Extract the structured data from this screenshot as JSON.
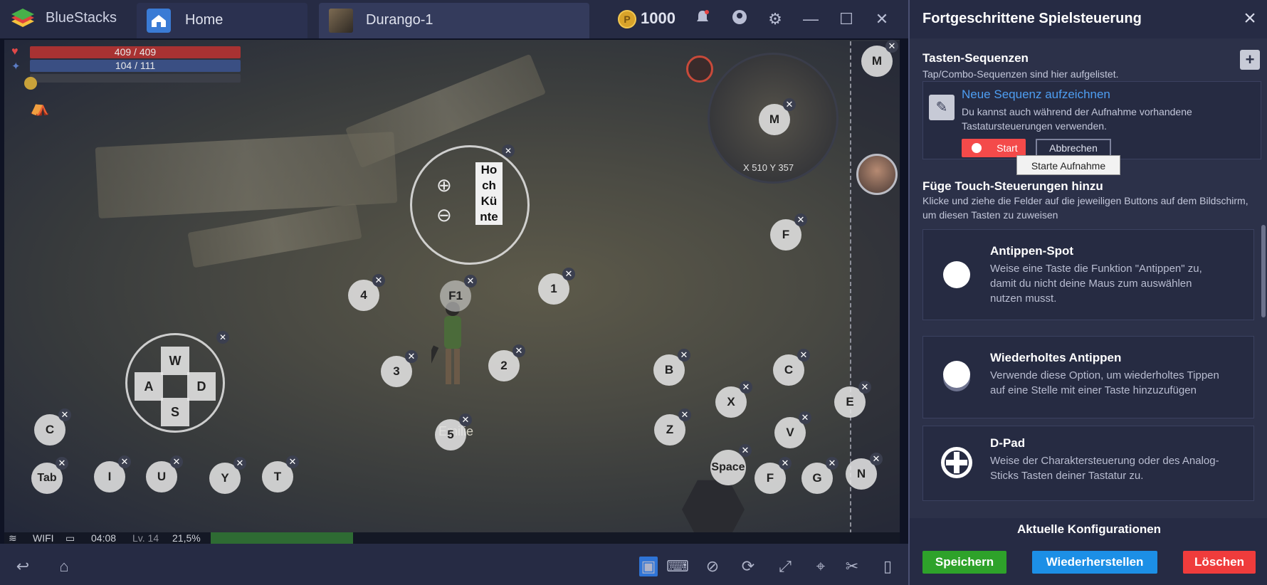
{
  "titlebar": {
    "brand": "BlueStacks",
    "tabs": [
      {
        "label": "Home",
        "icon": "home-icon"
      },
      {
        "label": "Durango-1",
        "icon": "game-thumbnail"
      }
    ],
    "coins": "1000",
    "icons": [
      "bell-icon",
      "account-icon",
      "gear-icon",
      "minimize-icon",
      "maximize-icon",
      "close-icon"
    ]
  },
  "game": {
    "hp": "409 / 409",
    "mp": "104 / 111",
    "minimap_coords": "X 510 Y 357",
    "player_name": "Emilie",
    "zoom_label": "Ho ch Kü nte",
    "status": {
      "wifi": "WIFI",
      "time": "04:08",
      "level": "Lv. 14",
      "percent": "21,5%"
    },
    "dpad": {
      "up": "W",
      "left": "A",
      "right": "D",
      "down": "S"
    },
    "keys": [
      "M",
      "M",
      "F",
      "1",
      "4",
      "F1",
      "2",
      "3",
      "5",
      "B",
      "C",
      "X",
      "E",
      "Z",
      "V",
      "Space",
      "F",
      "G",
      "N",
      "C",
      "Tab",
      "I",
      "U",
      "Y",
      "T"
    ]
  },
  "bottombar": {
    "icons": [
      "back-icon",
      "home-icon",
      "keymap-icon",
      "keyboard-icon",
      "eye-off-icon",
      "screen-rotate-icon",
      "fullscreen-icon",
      "location-icon",
      "scissors-icon",
      "phone-icon"
    ]
  },
  "panel": {
    "title": "Fortgeschrittene Spielsteuerung",
    "sequences": {
      "title": "Tasten-Sequenzen",
      "subtitle": "Tap/Combo-Sequenzen sind hier aufgelistet.",
      "new_link": "Neue Sequenz aufzeichnen",
      "desc": "Du kannst auch während der Aufnahme vorhandene Tastatursteuerungen verwenden.",
      "start": "Start",
      "cancel": "Abbrechen",
      "tooltip": "Starte Aufnahme"
    },
    "touch": {
      "title": "Füge Touch-Steuerungen hinzu",
      "subtitle": "Klicke und ziehe die Felder auf die jeweiligen Buttons auf dem Bildschirm, um diesen Tasten zu zuweisen"
    },
    "cards": [
      {
        "title": "Antippen-Spot",
        "desc": "Weise eine Taste die Funktion \"Antippen\" zu, damit du nicht deine Maus zum auswählen nutzen musst.",
        "icon": "tap-spot-icon"
      },
      {
        "title": "Wiederholtes Antippen",
        "desc": "Verwende diese Option, um wiederholtes Tippen auf eine Stelle mit einer Taste hinzuzufügen",
        "icon": "repeated-tap-icon"
      },
      {
        "title": "D-Pad",
        "desc": "Weise der Charaktersteuerung oder des Analog-Sticks Tasten deiner Tastatur zu.",
        "icon": "dpad-icon"
      }
    ],
    "footer": {
      "title": "Aktuelle Konfigurationen",
      "save": "Speichern",
      "restore": "Wiederherstellen",
      "delete": "Löschen"
    },
    "colors": {
      "save": "#2ea22a",
      "restore": "#1c8fe6",
      "delete": "#ef3c3c",
      "link": "#4e9ef2"
    }
  }
}
